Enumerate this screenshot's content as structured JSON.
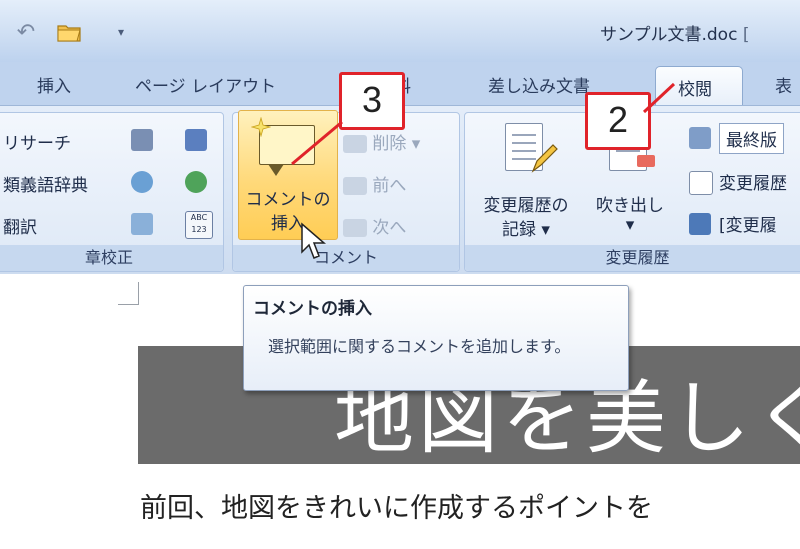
{
  "window": {
    "doc_title": "サンプル文書.doc",
    "title_overflow": "[",
    "qat_more": "▾"
  },
  "tabs": {
    "insert": "挿入",
    "page_layout": "ページ レイアウト",
    "references": "資料",
    "mailings": "差し込み文書",
    "review": "校閲",
    "view_partial": "表"
  },
  "ribbon": {
    "proofing": {
      "label": "章校正",
      "research": "リサーチ",
      "thesaurus": "類義語辞典",
      "translate": "翻訳"
    },
    "comments": {
      "label": "コメント",
      "insert_line1": "コメントの",
      "insert_line2": "挿入",
      "delete": "削除",
      "previous": "前へ",
      "next": "次へ"
    },
    "tracking": {
      "label": "変更履歴",
      "track_changes_line1": "変更履歴の",
      "track_changes_line2": "記録",
      "balloons": "吹き出し",
      "final_view": "最終版",
      "show_markup": "変更履歴",
      "reviewing_pane": "[変更履"
    },
    "abc_icon_text": "ABC",
    "num_icon_text": "123"
  },
  "callouts": {
    "step2": "2",
    "step3": "3"
  },
  "tooltip": {
    "title": "コメントの挿入",
    "body": "選択範囲に関するコメントを追加します。"
  },
  "document": {
    "heading": "地図を美しく",
    "body": "前回、地図をきれいに作成するポイントを"
  },
  "colors": {
    "accent_red": "#e0232a",
    "hover_gold": "#ffd97a",
    "ribbon_blue": "#d7e4f5"
  }
}
